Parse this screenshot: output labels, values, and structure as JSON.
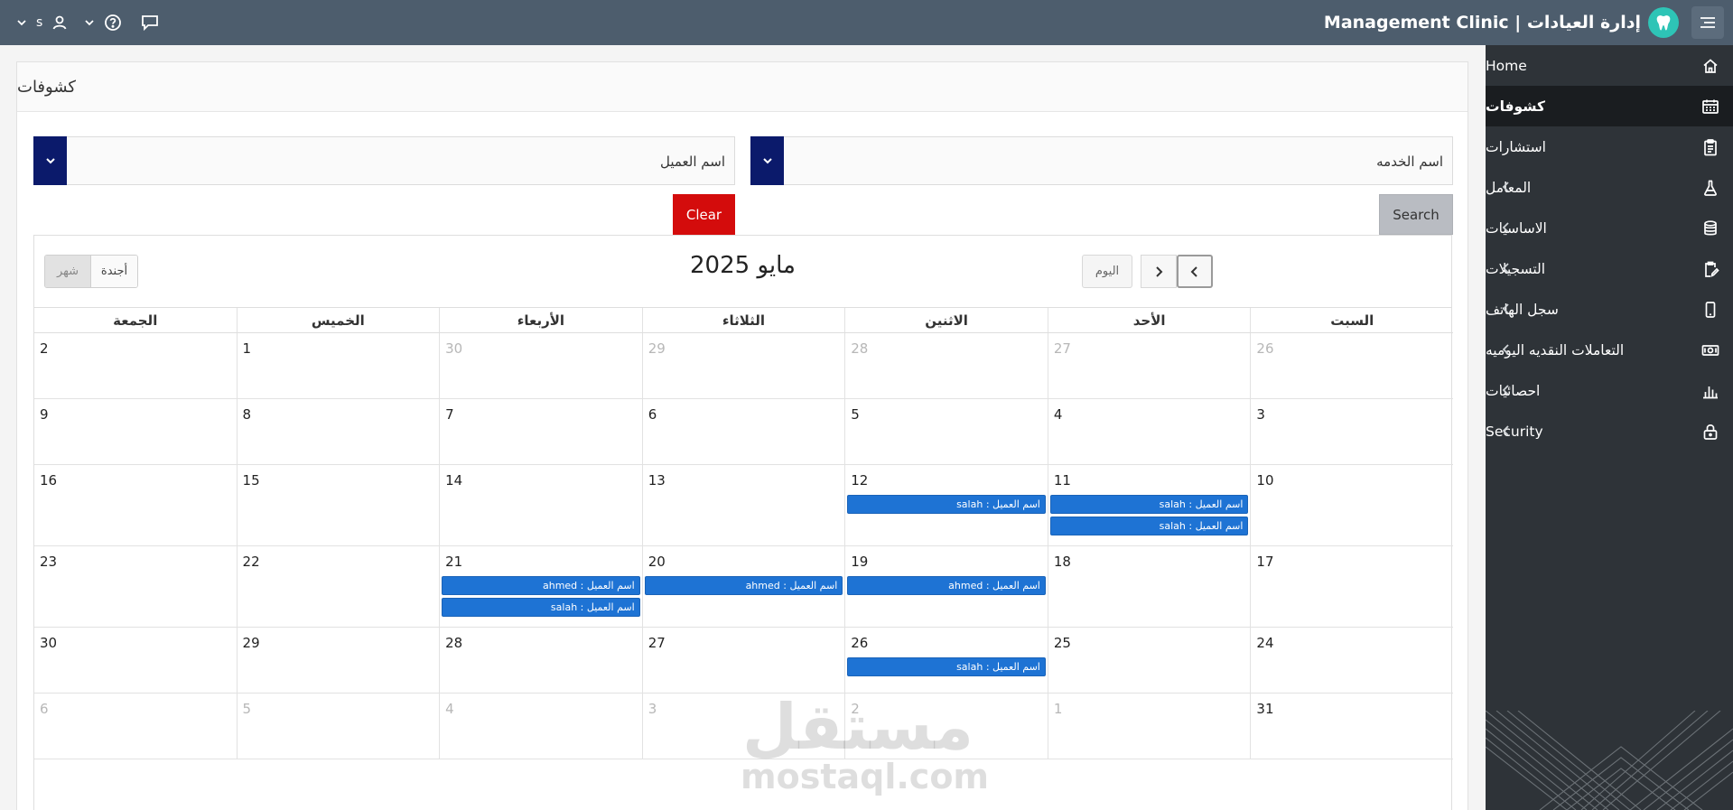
{
  "header": {
    "title": "Management Clinic | إدارة العيادات",
    "user_initial": "s"
  },
  "sidebar": {
    "items": [
      {
        "label": "Home",
        "icon": "home-icon",
        "has_children": false,
        "active": false
      },
      {
        "label": "كشوفات",
        "icon": "calendar-icon",
        "has_children": false,
        "active": true
      },
      {
        "label": "استشارات",
        "icon": "clipboard-icon",
        "has_children": false,
        "active": false
      },
      {
        "label": "المعامل",
        "icon": "flask-icon",
        "has_children": true,
        "active": false
      },
      {
        "label": "الاساسيات",
        "icon": "database-icon",
        "has_children": true,
        "active": false
      },
      {
        "label": "التسجيلات",
        "icon": "clipboard-edit-icon",
        "has_children": true,
        "active": false
      },
      {
        "label": "سجل الهاتف",
        "icon": "phone-icon",
        "has_children": true,
        "active": false
      },
      {
        "label": "التعاملات النقديه اليوميه",
        "icon": "money-icon",
        "has_children": true,
        "active": false
      },
      {
        "label": "احصائيات",
        "icon": "bar-chart-icon",
        "has_children": true,
        "active": false
      },
      {
        "label": "Security",
        "icon": "lock-icon",
        "has_children": true,
        "active": false
      }
    ]
  },
  "page": {
    "title": "كشوفات"
  },
  "filters": {
    "service_placeholder": "اسم الخدمه",
    "client_placeholder": "اسم العميل",
    "search_label": "Search",
    "clear_label": "Clear"
  },
  "calendar": {
    "title": "مايو 2025",
    "today_label": "اليوم",
    "view_month": "شهر",
    "view_agenda": "أجندة",
    "weekdays": [
      "السبت",
      "الأحد",
      "الاثنين",
      "الثلاثاء",
      "الأربعاء",
      "الخميس",
      "الجمعة"
    ],
    "weeks": [
      {
        "height": 73,
        "days": [
          {
            "n": "26",
            "o": true
          },
          {
            "n": "27",
            "o": true
          },
          {
            "n": "28",
            "o": true
          },
          {
            "n": "29",
            "o": true
          },
          {
            "n": "30",
            "o": true
          },
          {
            "n": "1",
            "o": false
          },
          {
            "n": "2",
            "o": false
          }
        ]
      },
      {
        "height": 73,
        "days": [
          {
            "n": "3",
            "o": false
          },
          {
            "n": "4",
            "o": false
          },
          {
            "n": "5",
            "o": false
          },
          {
            "n": "6",
            "o": false
          },
          {
            "n": "7",
            "o": false
          },
          {
            "n": "8",
            "o": false
          },
          {
            "n": "9",
            "o": false
          }
        ]
      },
      {
        "height": 90,
        "days": [
          {
            "n": "10",
            "o": false
          },
          {
            "n": "11",
            "o": false,
            "ev": [
              "اسم العميل : salah",
              "اسم العميل : salah"
            ]
          },
          {
            "n": "12",
            "o": false,
            "ev": [
              "اسم العميل : salah"
            ]
          },
          {
            "n": "13",
            "o": false
          },
          {
            "n": "14",
            "o": false
          },
          {
            "n": "15",
            "o": false
          },
          {
            "n": "16",
            "o": false
          }
        ]
      },
      {
        "height": 90,
        "days": [
          {
            "n": "17",
            "o": false
          },
          {
            "n": "18",
            "o": false
          },
          {
            "n": "19",
            "o": false,
            "ev": [
              "اسم العميل : ahmed"
            ]
          },
          {
            "n": "20",
            "o": false,
            "ev": [
              "اسم العميل : ahmed"
            ]
          },
          {
            "n": "21",
            "o": false,
            "ev": [
              "اسم العميل : ahmed",
              "اسم العميل : salah"
            ]
          },
          {
            "n": "22",
            "o": false
          },
          {
            "n": "23",
            "o": false
          }
        ]
      },
      {
        "height": 73,
        "days": [
          {
            "n": "24",
            "o": false
          },
          {
            "n": "25",
            "o": false
          },
          {
            "n": "26",
            "o": false,
            "ev": [
              "اسم العميل : salah"
            ]
          },
          {
            "n": "27",
            "o": false
          },
          {
            "n": "28",
            "o": false
          },
          {
            "n": "29",
            "o": false
          },
          {
            "n": "30",
            "o": false
          }
        ]
      },
      {
        "height": 73,
        "days": [
          {
            "n": "31",
            "o": false
          },
          {
            "n": "1",
            "o": true
          },
          {
            "n": "2",
            "o": true
          },
          {
            "n": "3",
            "o": true
          },
          {
            "n": "4",
            "o": true
          },
          {
            "n": "5",
            "o": true
          },
          {
            "n": "6",
            "o": true
          }
        ]
      }
    ]
  },
  "watermark": {
    "arabic": "مستقل",
    "latin": "mostaql.com"
  },
  "colors": {
    "header_bg": "#4d5d6d",
    "sidebar_bg": "#2e3338",
    "select_button": "#0b1a6b",
    "clear_button": "#d40c0c",
    "event_bg": "#1e73d4"
  }
}
